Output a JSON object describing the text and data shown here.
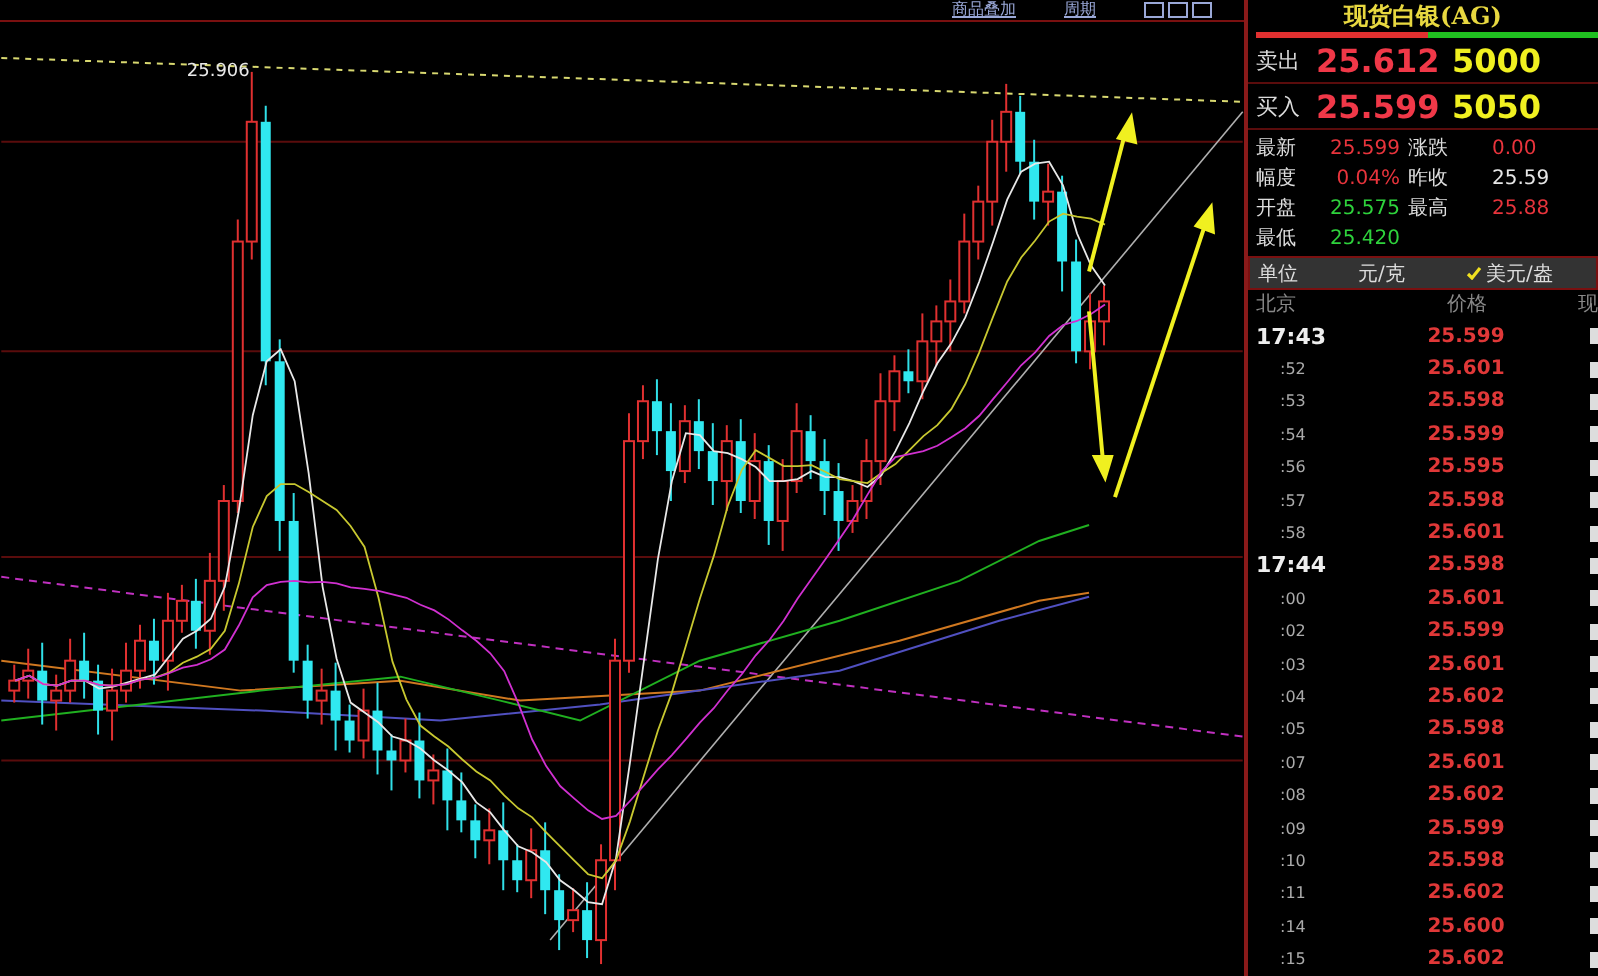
{
  "toolbar": {
    "links": [
      "商品叠加",
      "周期"
    ]
  },
  "chart": {
    "high_label": "25.906"
  },
  "quote": {
    "title": "现货白银(AG)",
    "orders": [
      {
        "label": "卖出",
        "price": "25.612",
        "volume": "5000"
      },
      {
        "label": "买入",
        "price": "25.599",
        "volume": "5050"
      }
    ],
    "stats": [
      {
        "label": "最新",
        "value": "25.599",
        "color": "#e8343c"
      },
      {
        "label": "涨跌",
        "value": "0.00",
        "color": "#e8343c"
      },
      {
        "label": "幅度",
        "value": "0.04%",
        "color": "#e8343c"
      },
      {
        "label": "昨收",
        "value": "25.59",
        "color": "#e6e6e6"
      },
      {
        "label": "开盘",
        "value": "25.575",
        "color": "#2ed23c"
      },
      {
        "label": "最高",
        "value": "25.88",
        "color": "#e8343c"
      },
      {
        "label": "最低",
        "value": "25.420",
        "color": "#2ed23c"
      }
    ],
    "unit": {
      "label": "单位",
      "options": [
        {
          "label": "元/克",
          "selected": false
        },
        {
          "label": "美元/盎",
          "selected": true
        }
      ]
    },
    "ticks_header": [
      "北京",
      "价格",
      "现"
    ],
    "ticks": [
      {
        "time": "17:43",
        "price": "25.599",
        "kind": "minute"
      },
      {
        "time": ":52",
        "price": "25.601",
        "kind": "second"
      },
      {
        "time": ":53",
        "price": "25.598",
        "kind": "second"
      },
      {
        "time": ":54",
        "price": "25.599",
        "kind": "second"
      },
      {
        "time": ":56",
        "price": "25.595",
        "kind": "second"
      },
      {
        "time": ":57",
        "price": "25.598",
        "kind": "second"
      },
      {
        "time": ":58",
        "price": "25.601",
        "kind": "second"
      },
      {
        "time": "17:44",
        "price": "25.598",
        "kind": "minute"
      },
      {
        "time": ":00",
        "price": "25.601",
        "kind": "second"
      },
      {
        "time": ":02",
        "price": "25.599",
        "kind": "second"
      },
      {
        "time": ":03",
        "price": "25.601",
        "kind": "second"
      },
      {
        "time": ":04",
        "price": "25.602",
        "kind": "second"
      },
      {
        "time": ":05",
        "price": "25.598",
        "kind": "second"
      },
      {
        "time": ":07",
        "price": "25.601",
        "kind": "second"
      },
      {
        "time": ":08",
        "price": "25.602",
        "kind": "second"
      },
      {
        "time": ":09",
        "price": "25.599",
        "kind": "second"
      },
      {
        "time": ":10",
        "price": "25.598",
        "kind": "second"
      },
      {
        "time": ":11",
        "price": "25.602",
        "kind": "second"
      },
      {
        "time": ":14",
        "price": "25.600",
        "kind": "second"
      },
      {
        "time": ":15",
        "price": "25.602",
        "kind": "second"
      }
    ]
  }
}
